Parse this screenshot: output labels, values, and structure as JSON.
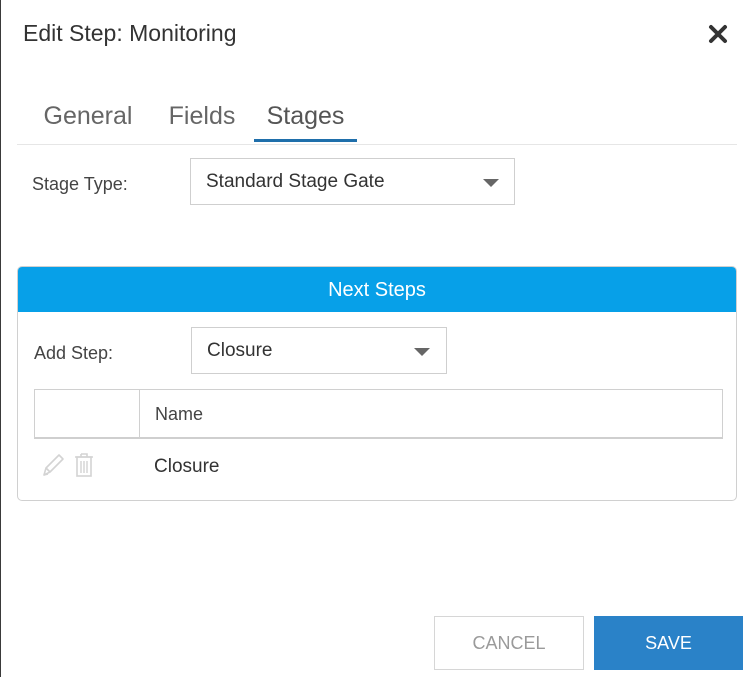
{
  "dialog": {
    "title": "Edit Step: Monitoring"
  },
  "tabs": [
    {
      "label": "General"
    },
    {
      "label": "Fields"
    },
    {
      "label": "Stages"
    }
  ],
  "stage_type": {
    "label": "Stage Type:",
    "value": "Standard Stage Gate"
  },
  "next_steps": {
    "header": "Next Steps",
    "add_step_label": "Add Step:",
    "add_step_value": "Closure",
    "table": {
      "columns": [
        "",
        "Name"
      ],
      "rows": [
        {
          "name": "Closure"
        }
      ]
    }
  },
  "footer": {
    "cancel_label": "CANCEL",
    "save_label": "SAVE"
  },
  "colors": {
    "panel_header": "#07a0e8",
    "active_tab": "#1f6fab",
    "save_button": "#2a82c8"
  }
}
